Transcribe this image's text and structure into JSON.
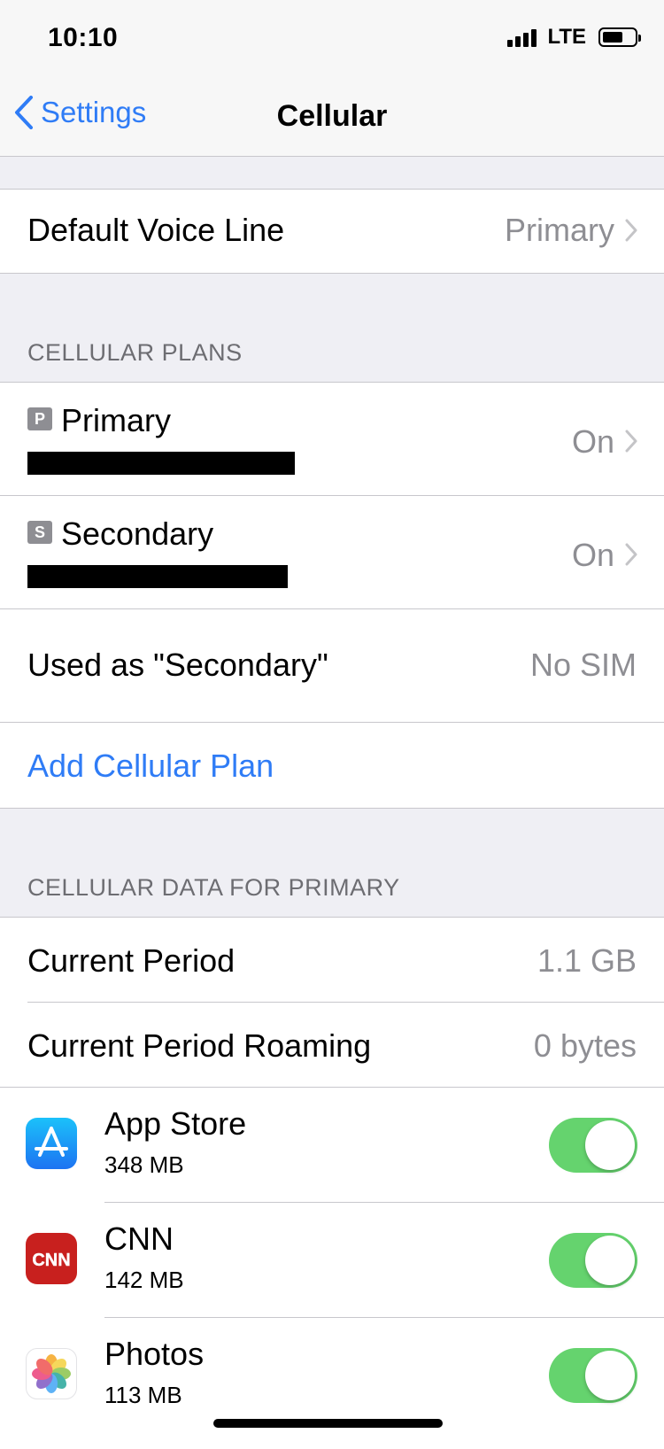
{
  "status_bar": {
    "time": "10:10",
    "network": "LTE",
    "battery_level": 0.65
  },
  "nav": {
    "back_label": "Settings",
    "title": "Cellular"
  },
  "default_voice": {
    "label": "Default Voice Line",
    "value": "Primary"
  },
  "plans_section": {
    "header": "CELLULAR PLANS",
    "plans": [
      {
        "badge": "P",
        "name": "Primary",
        "status": "On"
      },
      {
        "badge": "S",
        "name": "Secondary",
        "status": "On"
      }
    ],
    "used_as": {
      "label": "Used as \"Secondary\"",
      "value": "No SIM"
    },
    "add_plan": "Add Cellular Plan"
  },
  "data_section": {
    "header": "CELLULAR DATA FOR PRIMARY",
    "current_period": {
      "label": "Current Period",
      "value": "1.1 GB"
    },
    "roaming": {
      "label": "Current Period Roaming",
      "value": "0 bytes"
    },
    "apps": [
      {
        "name": "App Store",
        "usage": "348 MB",
        "enabled": true,
        "icon": "app-store-icon",
        "icon_color": "#1a8cf8"
      },
      {
        "name": "CNN",
        "usage": "142 MB",
        "enabled": true,
        "icon": "cnn-icon",
        "icon_color": "#c8201e"
      },
      {
        "name": "Photos",
        "usage": "113 MB",
        "enabled": true,
        "icon": "photos-icon",
        "icon_color": "#ffffff"
      }
    ]
  },
  "colors": {
    "accent": "#2f7cf6",
    "toggle_on": "#65d36e",
    "secondary_text": "#8e8e93"
  }
}
